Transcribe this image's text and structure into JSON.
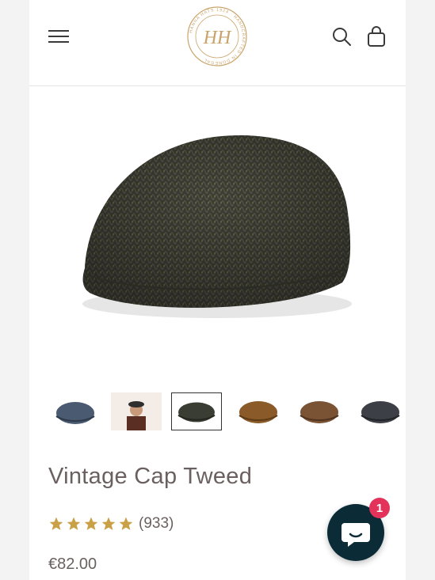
{
  "brand": {
    "logo_monogram": "HH",
    "logo_ring_text": "HANNA HATS 1924 · HANDCRAFTED IN DONEGAL",
    "accent_color": "#c9a46a"
  },
  "header": {
    "menu_icon": "hamburger-menu-icon",
    "search_icon": "search-icon",
    "cart_icon": "shopping-bag-icon"
  },
  "product": {
    "title": "Vintage Cap Tweed",
    "rating": {
      "stars": 5,
      "count_label": "(933)"
    },
    "price": "€82.00",
    "thumbnails": [
      {
        "name": "navy tweed cap",
        "color": "#4a5a70"
      },
      {
        "name": "model wearing cap",
        "color": "#6a3a2a"
      },
      {
        "name": "dark green tweed cap",
        "color": "#3a3d33",
        "selected": true
      },
      {
        "name": "brown cap",
        "color": "#8a5a28"
      },
      {
        "name": "chestnut tweed cap",
        "color": "#7a5234"
      },
      {
        "name": "charcoal cap",
        "color": "#3c3f45"
      }
    ]
  },
  "chat": {
    "badge_count": "1",
    "icon": "chat-bubble-icon",
    "color": "#0b2b36"
  }
}
